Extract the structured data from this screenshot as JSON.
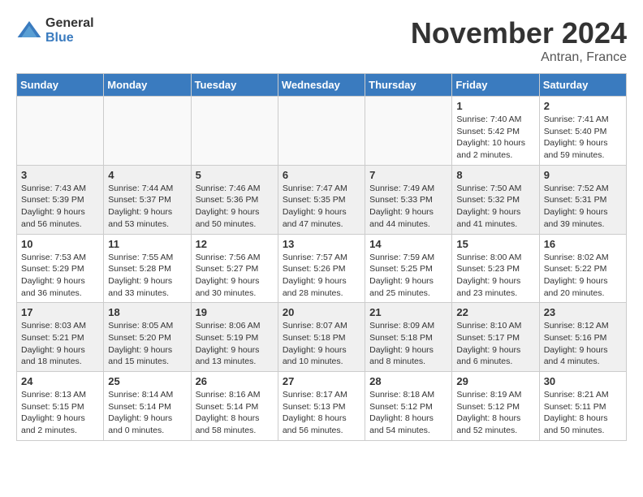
{
  "header": {
    "logo_general": "General",
    "logo_blue": "Blue",
    "month_title": "November 2024",
    "subtitle": "Antran, France"
  },
  "days_of_week": [
    "Sunday",
    "Monday",
    "Tuesday",
    "Wednesday",
    "Thursday",
    "Friday",
    "Saturday"
  ],
  "weeks": [
    [
      {
        "day": "",
        "content": ""
      },
      {
        "day": "",
        "content": ""
      },
      {
        "day": "",
        "content": ""
      },
      {
        "day": "",
        "content": ""
      },
      {
        "day": "",
        "content": ""
      },
      {
        "day": "1",
        "content": "Sunrise: 7:40 AM\nSunset: 5:42 PM\nDaylight: 10 hours and 2 minutes."
      },
      {
        "day": "2",
        "content": "Sunrise: 7:41 AM\nSunset: 5:40 PM\nDaylight: 9 hours and 59 minutes."
      }
    ],
    [
      {
        "day": "3",
        "content": "Sunrise: 7:43 AM\nSunset: 5:39 PM\nDaylight: 9 hours and 56 minutes."
      },
      {
        "day": "4",
        "content": "Sunrise: 7:44 AM\nSunset: 5:37 PM\nDaylight: 9 hours and 53 minutes."
      },
      {
        "day": "5",
        "content": "Sunrise: 7:46 AM\nSunset: 5:36 PM\nDaylight: 9 hours and 50 minutes."
      },
      {
        "day": "6",
        "content": "Sunrise: 7:47 AM\nSunset: 5:35 PM\nDaylight: 9 hours and 47 minutes."
      },
      {
        "day": "7",
        "content": "Sunrise: 7:49 AM\nSunset: 5:33 PM\nDaylight: 9 hours and 44 minutes."
      },
      {
        "day": "8",
        "content": "Sunrise: 7:50 AM\nSunset: 5:32 PM\nDaylight: 9 hours and 41 minutes."
      },
      {
        "day": "9",
        "content": "Sunrise: 7:52 AM\nSunset: 5:31 PM\nDaylight: 9 hours and 39 minutes."
      }
    ],
    [
      {
        "day": "10",
        "content": "Sunrise: 7:53 AM\nSunset: 5:29 PM\nDaylight: 9 hours and 36 minutes."
      },
      {
        "day": "11",
        "content": "Sunrise: 7:55 AM\nSunset: 5:28 PM\nDaylight: 9 hours and 33 minutes."
      },
      {
        "day": "12",
        "content": "Sunrise: 7:56 AM\nSunset: 5:27 PM\nDaylight: 9 hours and 30 minutes."
      },
      {
        "day": "13",
        "content": "Sunrise: 7:57 AM\nSunset: 5:26 PM\nDaylight: 9 hours and 28 minutes."
      },
      {
        "day": "14",
        "content": "Sunrise: 7:59 AM\nSunset: 5:25 PM\nDaylight: 9 hours and 25 minutes."
      },
      {
        "day": "15",
        "content": "Sunrise: 8:00 AM\nSunset: 5:23 PM\nDaylight: 9 hours and 23 minutes."
      },
      {
        "day": "16",
        "content": "Sunrise: 8:02 AM\nSunset: 5:22 PM\nDaylight: 9 hours and 20 minutes."
      }
    ],
    [
      {
        "day": "17",
        "content": "Sunrise: 8:03 AM\nSunset: 5:21 PM\nDaylight: 9 hours and 18 minutes."
      },
      {
        "day": "18",
        "content": "Sunrise: 8:05 AM\nSunset: 5:20 PM\nDaylight: 9 hours and 15 minutes."
      },
      {
        "day": "19",
        "content": "Sunrise: 8:06 AM\nSunset: 5:19 PM\nDaylight: 9 hours and 13 minutes."
      },
      {
        "day": "20",
        "content": "Sunrise: 8:07 AM\nSunset: 5:18 PM\nDaylight: 9 hours and 10 minutes."
      },
      {
        "day": "21",
        "content": "Sunrise: 8:09 AM\nSunset: 5:18 PM\nDaylight: 9 hours and 8 minutes."
      },
      {
        "day": "22",
        "content": "Sunrise: 8:10 AM\nSunset: 5:17 PM\nDaylight: 9 hours and 6 minutes."
      },
      {
        "day": "23",
        "content": "Sunrise: 8:12 AM\nSunset: 5:16 PM\nDaylight: 9 hours and 4 minutes."
      }
    ],
    [
      {
        "day": "24",
        "content": "Sunrise: 8:13 AM\nSunset: 5:15 PM\nDaylight: 9 hours and 2 minutes."
      },
      {
        "day": "25",
        "content": "Sunrise: 8:14 AM\nSunset: 5:14 PM\nDaylight: 9 hours and 0 minutes."
      },
      {
        "day": "26",
        "content": "Sunrise: 8:16 AM\nSunset: 5:14 PM\nDaylight: 8 hours and 58 minutes."
      },
      {
        "day": "27",
        "content": "Sunrise: 8:17 AM\nSunset: 5:13 PM\nDaylight: 8 hours and 56 minutes."
      },
      {
        "day": "28",
        "content": "Sunrise: 8:18 AM\nSunset: 5:12 PM\nDaylight: 8 hours and 54 minutes."
      },
      {
        "day": "29",
        "content": "Sunrise: 8:19 AM\nSunset: 5:12 PM\nDaylight: 8 hours and 52 minutes."
      },
      {
        "day": "30",
        "content": "Sunrise: 8:21 AM\nSunset: 5:11 PM\nDaylight: 8 hours and 50 minutes."
      }
    ]
  ]
}
